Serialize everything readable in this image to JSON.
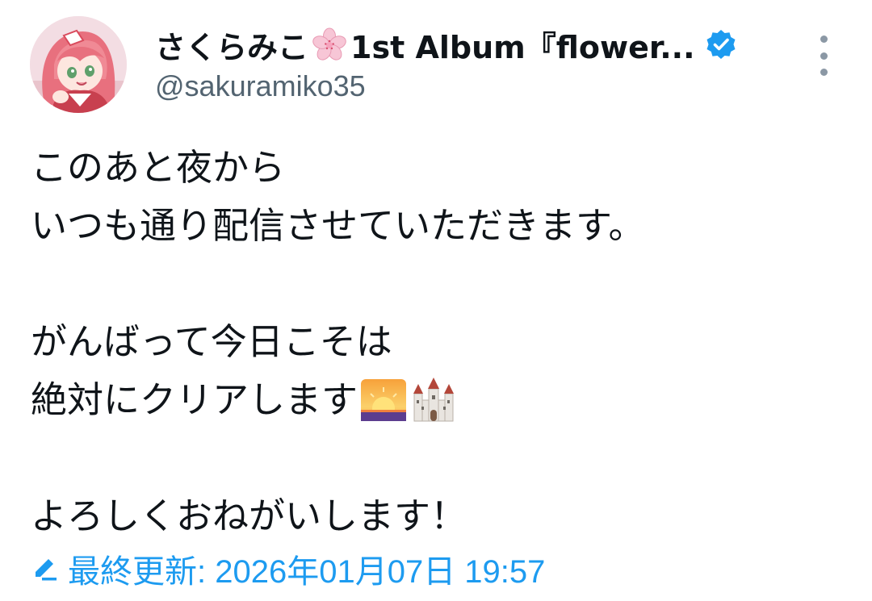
{
  "author": {
    "display_name_prefix": "さくらみこ",
    "display_name_suffix": "1st Album『flower...",
    "handle": "@sakuramiko35",
    "verified": true
  },
  "tweet": {
    "lines": [
      "このあと夜から",
      "いつも通り配信させていただきます。",
      "",
      "がんばって今日こそは",
      "絶対にクリアします",
      "",
      "よろしくおねがいします！"
    ],
    "line5_emojis": [
      "sunrise-icon",
      "castle-icon"
    ]
  },
  "footer": {
    "edited_label": "最終更新: 2026年01月07日 19:57"
  },
  "colors": {
    "accent": "#1d9bf0",
    "text": "#0f1419",
    "secondary": "#536471"
  }
}
